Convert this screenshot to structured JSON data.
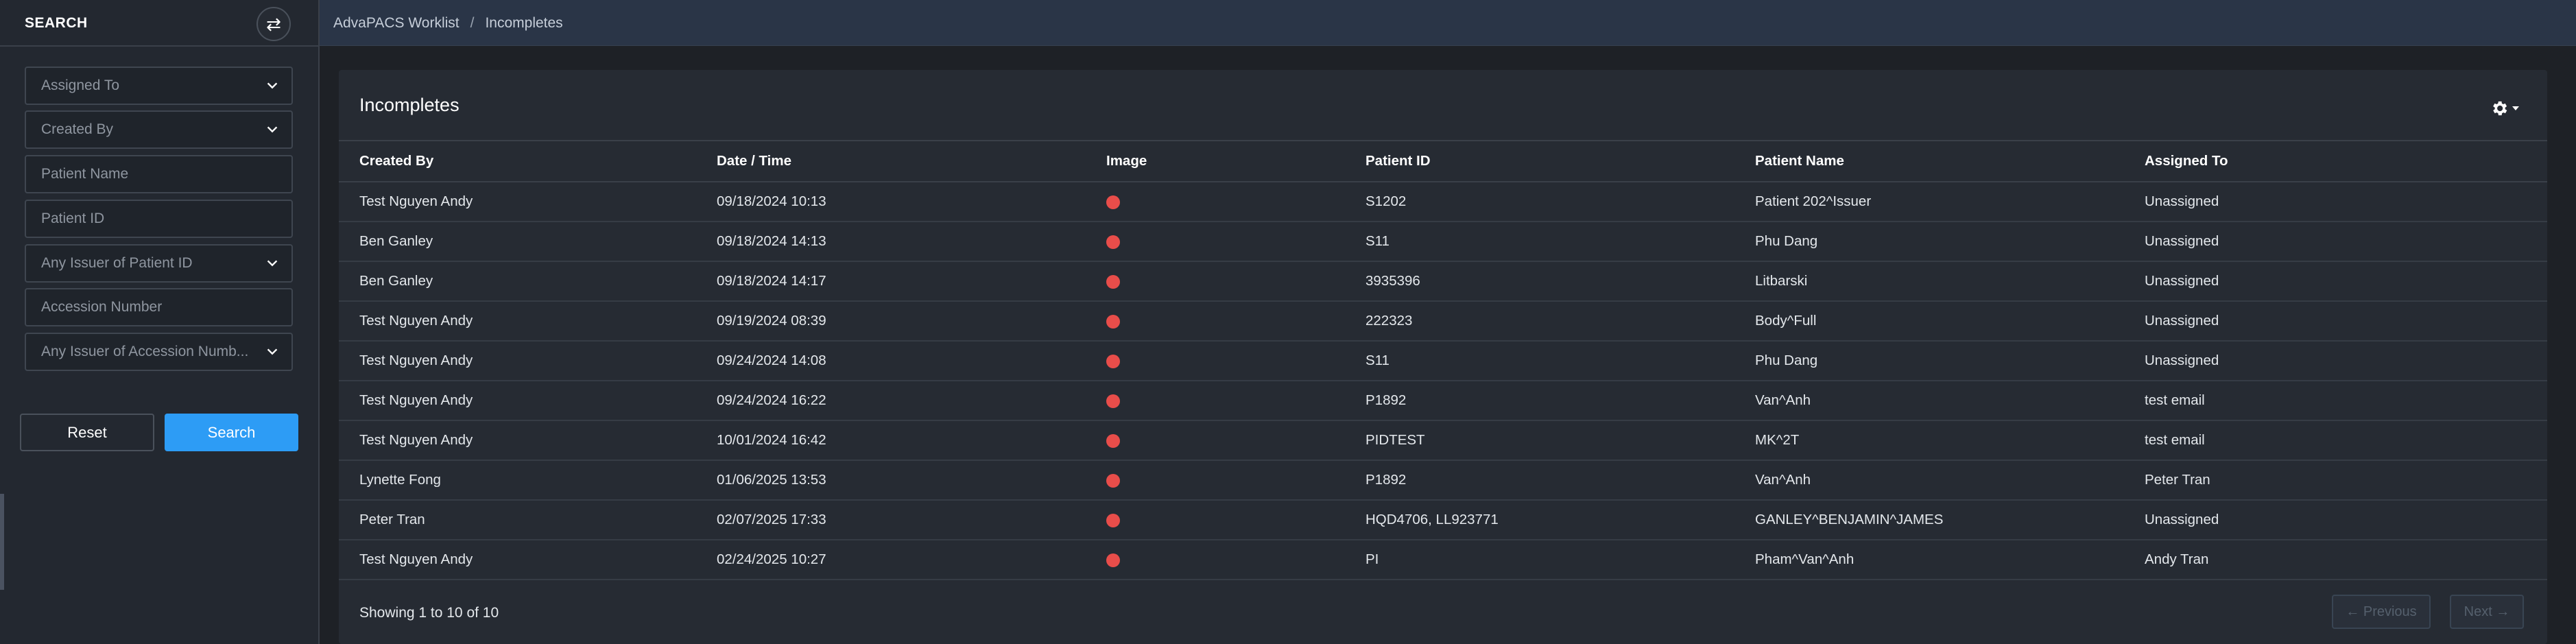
{
  "sidebar": {
    "title": "SEARCH",
    "fields": [
      {
        "label": "Assigned To",
        "type": "select"
      },
      {
        "label": "Created By",
        "type": "select"
      },
      {
        "label": "Patient Name",
        "type": "text"
      },
      {
        "label": "Patient ID",
        "type": "text"
      },
      {
        "label": "Any Issuer of Patient ID",
        "type": "select"
      },
      {
        "label": "Accession Number",
        "type": "text"
      },
      {
        "label": "Any Issuer of Accession Numb...",
        "type": "select"
      }
    ],
    "reset_label": "Reset",
    "search_label": "Search",
    "swap_icon": "swap-horizontal-icon"
  },
  "breadcrumb": {
    "root": "AdvaPACS Worklist",
    "separator": "/",
    "current": "Incompletes"
  },
  "panel": {
    "title": "Incompletes",
    "settings_icon": "gear-icon"
  },
  "table": {
    "columns": [
      "Created By",
      "Date / Time",
      "Image",
      "Patient ID",
      "Patient Name",
      "Assigned To"
    ],
    "rows": [
      {
        "created_by": "Test Nguyen Andy",
        "datetime": "09/18/2024 10:13",
        "patient_id": "S1202",
        "patient_name": "Patient 202^Issuer",
        "assigned_to": "Unassigned"
      },
      {
        "created_by": "Ben Ganley",
        "datetime": "09/18/2024 14:13",
        "patient_id": "S11",
        "patient_name": "Phu Dang",
        "assigned_to": "Unassigned"
      },
      {
        "created_by": "Ben Ganley",
        "datetime": "09/18/2024 14:17",
        "patient_id": "3935396",
        "patient_name": "Litbarski",
        "assigned_to": "Unassigned"
      },
      {
        "created_by": "Test Nguyen Andy",
        "datetime": "09/19/2024 08:39",
        "patient_id": "222323",
        "patient_name": "Body^Full",
        "assigned_to": "Unassigned"
      },
      {
        "created_by": "Test Nguyen Andy",
        "datetime": "09/24/2024 14:08",
        "patient_id": "S11",
        "patient_name": "Phu Dang",
        "assigned_to": "Unassigned"
      },
      {
        "created_by": "Test Nguyen Andy",
        "datetime": "09/24/2024 16:22",
        "patient_id": "P1892",
        "patient_name": "Van^Anh",
        "assigned_to": "test email"
      },
      {
        "created_by": "Test Nguyen Andy",
        "datetime": "10/01/2024 16:42",
        "patient_id": "PIDTEST",
        "patient_name": "MK^2T",
        "assigned_to": "test email"
      },
      {
        "created_by": "Lynette Fong",
        "datetime": "01/06/2025 13:53",
        "patient_id": "P1892",
        "patient_name": "Van^Anh",
        "assigned_to": "Peter Tran"
      },
      {
        "created_by": "Peter Tran",
        "datetime": "02/07/2025 17:33",
        "patient_id": "HQD4706, LL923771",
        "patient_name": "GANLEY^BENJAMIN^JAMES",
        "assigned_to": "Unassigned"
      },
      {
        "created_by": "Test Nguyen Andy",
        "datetime": "02/24/2025 10:27",
        "patient_id": "PI",
        "patient_name": "Pham^Van^Anh",
        "assigned_to": "Andy Tran"
      }
    ],
    "image_status_color": "#e84d4a"
  },
  "footer": {
    "showing": "Showing 1 to 10 of 10",
    "previous_label": "← Previous",
    "next_label": "Next →"
  },
  "colors": {
    "accent": "#2d9cf5",
    "topbar": "#2a3547",
    "panel": "#262b33"
  }
}
